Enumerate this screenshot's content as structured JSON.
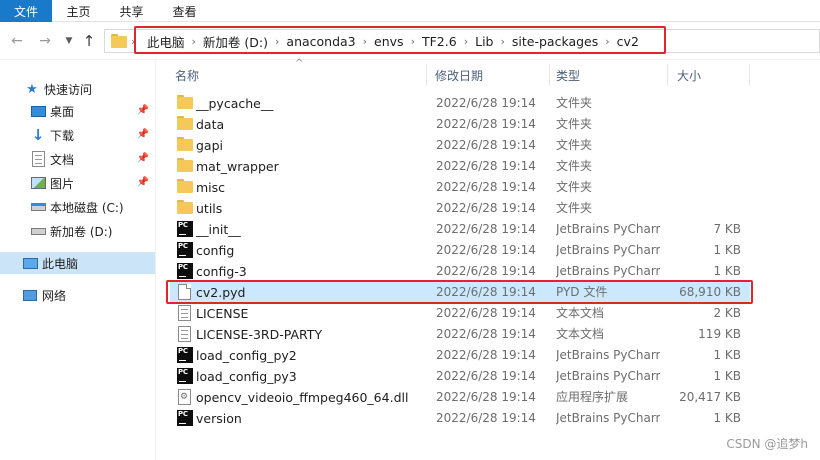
{
  "ribbon": {
    "tabs": [
      "文件",
      "主页",
      "共享",
      "查看"
    ]
  },
  "breadcrumb": [
    "此电脑",
    "新加卷 (D:)",
    "anaconda3",
    "envs",
    "TF2.6",
    "Lib",
    "site-packages",
    "cv2"
  ],
  "sidebar": {
    "quick_access": "快速访问",
    "items": [
      {
        "label": "桌面",
        "icon": "desktop-icon",
        "pinned": true
      },
      {
        "label": "下载",
        "icon": "download-icon",
        "pinned": true
      },
      {
        "label": "文档",
        "icon": "document-icon",
        "pinned": true
      },
      {
        "label": "图片",
        "icon": "picture-icon",
        "pinned": true
      },
      {
        "label": "本地磁盘 (C:)",
        "icon": "drive-icon",
        "pinned": false
      },
      {
        "label": "新加卷 (D:)",
        "icon": "drive-icon",
        "pinned": false
      }
    ],
    "this_pc": "此电脑",
    "network": "网络"
  },
  "columns": {
    "name": "名称",
    "date": "修改日期",
    "type": "类型",
    "size": "大小"
  },
  "files": [
    {
      "name": "__pycache__",
      "date": "2022/6/28 19:14",
      "type": "文件夹",
      "size": "",
      "icon": "folder"
    },
    {
      "name": "data",
      "date": "2022/6/28 19:14",
      "type": "文件夹",
      "size": "",
      "icon": "folder"
    },
    {
      "name": "gapi",
      "date": "2022/6/28 19:14",
      "type": "文件夹",
      "size": "",
      "icon": "folder"
    },
    {
      "name": "mat_wrapper",
      "date": "2022/6/28 19:14",
      "type": "文件夹",
      "size": "",
      "icon": "folder"
    },
    {
      "name": "misc",
      "date": "2022/6/28 19:14",
      "type": "文件夹",
      "size": "",
      "icon": "folder"
    },
    {
      "name": "utils",
      "date": "2022/6/28 19:14",
      "type": "文件夹",
      "size": "",
      "icon": "folder"
    },
    {
      "name": "__init__",
      "date": "2022/6/28 19:14",
      "type": "JetBrains PyCharm",
      "size": "7 KB",
      "icon": "pycharm"
    },
    {
      "name": "config",
      "date": "2022/6/28 19:14",
      "type": "JetBrains PyCharm",
      "size": "1 KB",
      "icon": "pycharm"
    },
    {
      "name": "config-3",
      "date": "2022/6/28 19:14",
      "type": "JetBrains PyCharm",
      "size": "1 KB",
      "icon": "pycharm"
    },
    {
      "name": "cv2.pyd",
      "date": "2022/6/28 19:14",
      "type": "PYD 文件",
      "size": "68,910 KB",
      "icon": "file",
      "selected": true
    },
    {
      "name": "LICENSE",
      "date": "2022/6/28 19:14",
      "type": "文本文档",
      "size": "2 KB",
      "icon": "text"
    },
    {
      "name": "LICENSE-3RD-PARTY",
      "date": "2022/6/28 19:14",
      "type": "文本文档",
      "size": "119 KB",
      "icon": "text"
    },
    {
      "name": "load_config_py2",
      "date": "2022/6/28 19:14",
      "type": "JetBrains PyCharm",
      "size": "1 KB",
      "icon": "pycharm"
    },
    {
      "name": "load_config_py3",
      "date": "2022/6/28 19:14",
      "type": "JetBrains PyCharm",
      "size": "1 KB",
      "icon": "pycharm"
    },
    {
      "name": "opencv_videoio_ffmpeg460_64.dll",
      "date": "2022/6/28 19:14",
      "type": "应用程序扩展",
      "size": "20,417 KB",
      "icon": "dll"
    },
    {
      "name": "version",
      "date": "2022/6/28 19:14",
      "type": "JetBrains PyCharm",
      "size": "1 KB",
      "icon": "pycharm"
    }
  ],
  "watermark": "CSDN @追梦h",
  "colors": {
    "accent": "#1979ca",
    "highlight": "#e0262b",
    "selection": "#cce8ff"
  }
}
